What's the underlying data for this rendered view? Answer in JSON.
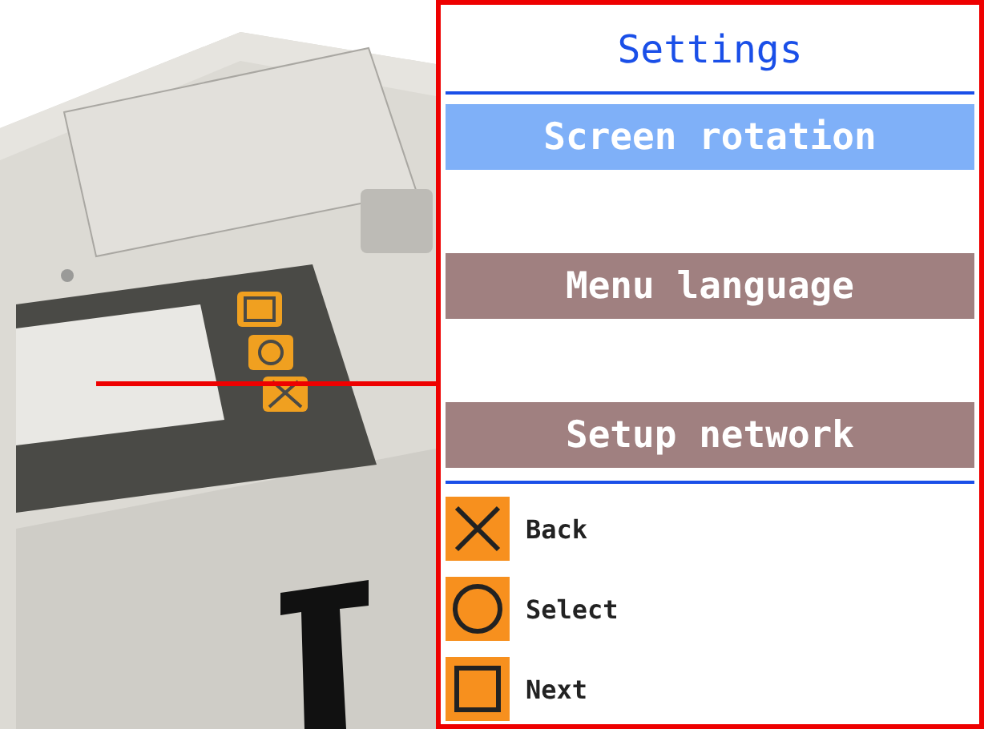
{
  "screen": {
    "title": "Settings",
    "menu_items": [
      {
        "label": "Screen rotation",
        "selected": true
      },
      {
        "label": "Menu language",
        "selected": false
      },
      {
        "label": "Setup network",
        "selected": false
      }
    ],
    "button_legend": [
      {
        "kind": "cross",
        "label": "Back"
      },
      {
        "kind": "circle",
        "label": "Select"
      },
      {
        "kind": "square",
        "label": "Next"
      }
    ]
  }
}
